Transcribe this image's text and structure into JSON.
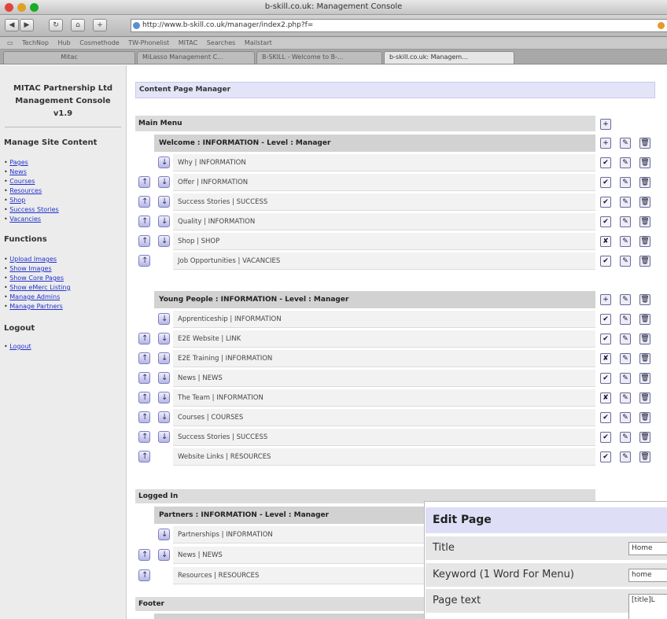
{
  "window": {
    "title": "b-skill.co.uk: Management Console"
  },
  "browser": {
    "url": "http://www.b-skill.co.uk/manager/index2.php?f=",
    "bookmarks": [
      "TechNop",
      "Hub",
      "Cosmethode",
      "TW-Phonelist",
      "MITAC",
      "Searches",
      "Mailstart"
    ],
    "tabs": [
      "Mitac",
      "MiLasso Management C...",
      "B-SKILL - Welcome to B-...",
      "b-skill.co.uk: Managem..."
    ]
  },
  "sidebar": {
    "brand_lines": [
      "MITAC Partnership Ltd",
      "Management Console",
      "v1.9"
    ],
    "manage_heading": "Manage Site Content",
    "manage_links": [
      "Pages",
      "News",
      "Courses",
      "Resources",
      "Shop",
      "Success Stories",
      "Vacancies"
    ],
    "functions_heading": "Functions",
    "function_links": [
      "Upload Images",
      "Show Images",
      "Show Core Pages",
      "Show eMerc Listing",
      "Manage Admins",
      "Manage Partners"
    ],
    "logout_heading": "Logout",
    "logout_links": [
      "Logout"
    ]
  },
  "main": {
    "header": "Content Page Manager",
    "main_menu": "Main Menu",
    "groups": [
      {
        "title": "Welcome : INFORMATION - Level : Manager",
        "rows": [
          {
            "label": "Why | INFORMATION",
            "up": false,
            "down": true,
            "status": "✔"
          },
          {
            "label": "Offer | INFORMATION",
            "up": true,
            "down": true,
            "status": "✔"
          },
          {
            "label": "Success Stories | SUCCESS",
            "up": true,
            "down": true,
            "status": "✔"
          },
          {
            "label": "Quality | INFORMATION",
            "up": true,
            "down": true,
            "status": "✔"
          },
          {
            "label": "Shop | SHOP",
            "up": true,
            "down": true,
            "status": "✘"
          },
          {
            "label": "Job Opportunities | VACANCIES",
            "up": true,
            "down": false,
            "status": "✔"
          }
        ]
      },
      {
        "title": "Young People : INFORMATION - Level : Manager",
        "rows": [
          {
            "label": "Apprenticeship | INFORMATION",
            "up": false,
            "down": true,
            "status": "✔"
          },
          {
            "label": "E2E Website | LINK",
            "up": true,
            "down": true,
            "status": "✔"
          },
          {
            "label": "E2E Training | INFORMATION",
            "up": true,
            "down": true,
            "status": "✘"
          },
          {
            "label": "News | NEWS",
            "up": true,
            "down": true,
            "status": "✔"
          },
          {
            "label": "The Team | INFORMATION",
            "up": true,
            "down": true,
            "status": "✘"
          },
          {
            "label": "Courses | COURSES",
            "up": true,
            "down": true,
            "status": "✔"
          },
          {
            "label": "Success Stories | SUCCESS",
            "up": true,
            "down": true,
            "status": "✔"
          },
          {
            "label": "Website Links | RESOURCES",
            "up": true,
            "down": false,
            "status": "✔"
          }
        ]
      }
    ],
    "logged_in": "Logged In",
    "partners": {
      "title": "Partners : INFORMATION - Level : Manager",
      "rows": [
        {
          "label": "Partnerships | INFORMATION",
          "up": false,
          "down": true
        },
        {
          "label": "News | NEWS",
          "up": true,
          "down": true
        },
        {
          "label": "Resources | RESOURCES",
          "up": true,
          "down": false
        }
      ]
    },
    "footer": "Footer"
  },
  "edit_page": {
    "title": "Edit Page",
    "fields": [
      {
        "label": "Title",
        "value": "Home"
      },
      {
        "label": "Keyword (1 Word For Menu)",
        "value": "home"
      },
      {
        "label": "Page text",
        "value": "[title]L"
      }
    ]
  }
}
